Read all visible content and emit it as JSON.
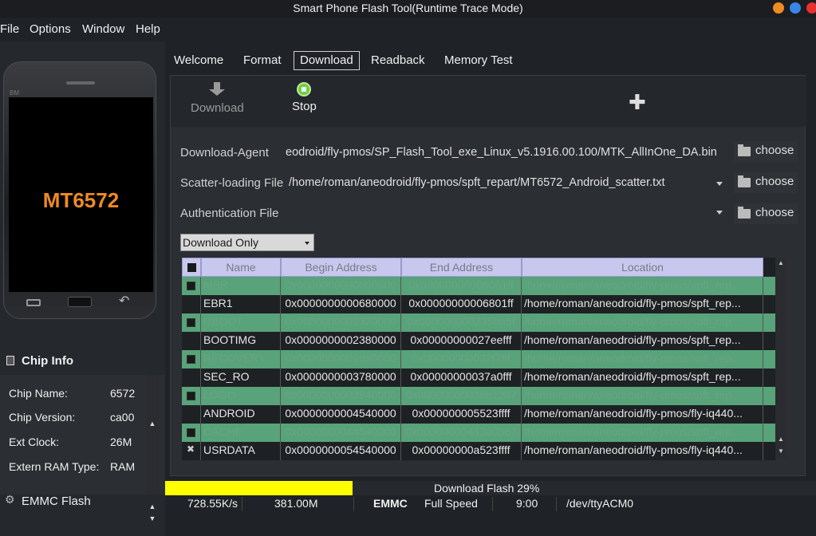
{
  "window": {
    "title": "Smart Phone Flash Tool(Runtime Trace Mode)",
    "buttons": [
      {
        "name": "minimize",
        "color": "#f08a22"
      },
      {
        "name": "maximize",
        "color": "#3a86e8"
      },
      {
        "name": "close",
        "color": "#e83030"
      }
    ]
  },
  "menu": [
    "File",
    "Options",
    "Window",
    "Help"
  ],
  "phone": {
    "brand": "BM",
    "chip_label": "MT6572"
  },
  "chip_info": {
    "header": "Chip Info",
    "rows": [
      {
        "label": "Chip Name:",
        "value": "6572"
      },
      {
        "label": "Chip Version:",
        "value": "ca00"
      },
      {
        "label": "Ext Clock:",
        "value": "26M"
      },
      {
        "label": "Extern RAM Type:",
        "value": "RAM"
      }
    ],
    "storage_label": "EMMC Flash"
  },
  "tabs": [
    {
      "label": "Welcome",
      "active": false
    },
    {
      "label": "Format",
      "active": false
    },
    {
      "label": "Download",
      "active": true
    },
    {
      "label": "Readback",
      "active": false
    },
    {
      "label": "Memory Test",
      "active": false
    }
  ],
  "toolbar": {
    "download_label": "Download",
    "stop_label": "Stop"
  },
  "form": {
    "download_agent_label": "Download-Agent",
    "download_agent_value": "eodroid/fly-pmos/SP_Flash_Tool_exe_Linux_v5.1916.00.100/MTK_AllInOne_DA.bin",
    "scatter_label": "Scatter-loading File",
    "scatter_value": "/home/roman/aneodroid/fly-pmos/spft_repart/MT6572_Android_scatter.txt",
    "auth_label": "Authentication File",
    "auth_value": "",
    "choose_label": "choose",
    "mode_value": "Download Only"
  },
  "table": {
    "columns": [
      "Name",
      "Begin Address",
      "End Address",
      "Location"
    ],
    "rows": [
      {
        "checked": true,
        "name": "MBR",
        "begin": "0x0000000000600000",
        "end": "0x00000000006001ff",
        "location": "/home/roman/aneodroid/fly-pmos/spft_rep...",
        "style": "green"
      },
      {
        "checked": false,
        "name": "EBR1",
        "begin": "0x0000000000680000",
        "end": "0x00000000006801ff",
        "location": "/home/roman/aneodroid/fly-pmos/spft_rep...",
        "style": "dark"
      },
      {
        "checked": true,
        "name": "UBOOT",
        "begin": "0x0000000002320000",
        "end": "0x000000000235ba5f",
        "location": "/home/roman/aneodroid/fly-pmos/spft_rep...",
        "style": "green"
      },
      {
        "checked": false,
        "name": "BOOTIMG",
        "begin": "0x0000000002380000",
        "end": "0x00000000027eefff",
        "location": "/home/roman/aneodroid/fly-pmos/spft_rep...",
        "style": "dark"
      },
      {
        "checked": true,
        "name": "RECOVERY",
        "begin": "0x0000000002d80000",
        "end": "0x00000000032f7fff",
        "location": "/home/roman/aneodroid/fly-pmos/spft_rep...",
        "style": "green"
      },
      {
        "checked": false,
        "name": "SEC_RO",
        "begin": "0x0000000003780000",
        "end": "0x00000000037a0fff",
        "location": "/home/roman/aneodroid/fly-pmos/spft_rep...",
        "style": "dark"
      },
      {
        "checked": true,
        "name": "LOGO",
        "begin": "0x0000000003840000",
        "end": "0x00000000038b1287",
        "location": "/home/roman/aneodroid/fly-pmos/spft_rep...",
        "style": "green"
      },
      {
        "checked": false,
        "name": "ANDROID",
        "begin": "0x0000000004540000",
        "end": "0x000000005523ffff",
        "location": "/home/roman/aneodroid/fly-pmos/fly-iq440...",
        "style": "dark"
      },
      {
        "checked": true,
        "name": "CACHE",
        "begin": "0x0000000044540000",
        "end": "0x00000000443a0b67",
        "location": "/home/roman/aneodroid/fly-pmos/spft_rep...",
        "style": "green"
      },
      {
        "checked": false,
        "name": "USRDATA",
        "begin": "0x0000000054540000",
        "end": "0x00000000a523ffff",
        "location": "/home/roman/aneodroid/fly-pmos/fly-iq440...",
        "style": "dark",
        "x_mark": true
      }
    ]
  },
  "progress": {
    "text": "Download Flash 29%",
    "fraction": 0.29
  },
  "status": {
    "speed": "728.55K/s",
    "size": "381.00M",
    "storage": "EMMC",
    "usb_speed": "Full Speed",
    "time": "9:00",
    "port": "/dev/ttyACM0"
  }
}
